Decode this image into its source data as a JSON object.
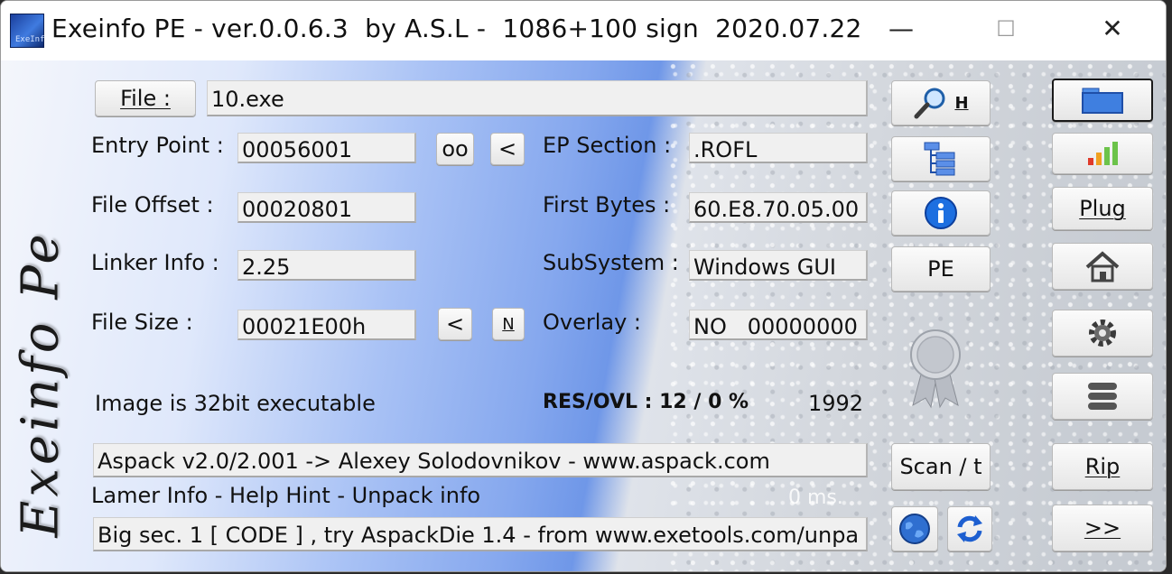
{
  "window": {
    "title": "Exeinfo PE - ver.0.0.6.3  by A.S.L -  1086+100 sign  2020.07.22",
    "icon_text": "ExeInf",
    "min_glyph": "—",
    "max_glyph": "☐",
    "close_glyph": "✕"
  },
  "logo_text": "Exeinfo Pe",
  "file": {
    "button_label": "File :",
    "value": "10.exe"
  },
  "fields": {
    "entry_point": {
      "label": "Entry Point :",
      "value": "00056001"
    },
    "file_offset": {
      "label": "File Offset :",
      "value": "00020801"
    },
    "linker_info": {
      "label": "Linker Info :",
      "value": "2.25"
    },
    "file_size": {
      "label": "File Size :",
      "value": "00021E00h"
    },
    "ep_section": {
      "label": "EP Section :",
      "value": ".ROFL"
    },
    "first_bytes": {
      "label": "First Bytes :",
      "value": "60.E8.70.05.00"
    },
    "subsystem": {
      "label": "SubSystem :",
      "value": "Windows GUI"
    },
    "overlay": {
      "label": "Overlay :",
      "value": "NO   00000000"
    }
  },
  "small_buttons": {
    "oo": "oo",
    "ep_prev": "<",
    "size_prev": "<",
    "n": "N"
  },
  "image_info": "Image is 32bit executable",
  "res_ovl": "RES/OVL : 12 / 0 %",
  "year": "1992",
  "detection": "Aspack v2.0/2.001  -> Alexey Solodovnikov - www.aspack.com",
  "lamer_info": "Lamer Info - Help Hint - Unpack info",
  "time_ms": "0 ms.",
  "hint": "Big sec. 1 [ CODE ] , try AspackDie 1.4 - from www.exetools.com/unpa",
  "mid_buttons": {
    "search_h": "H",
    "pe": "PE",
    "scan": "Scan / t"
  },
  "right_buttons": {
    "plug": "Plug",
    "rip": "Rip",
    "next": ">>"
  },
  "colors": {
    "info_blue": "#1d6fe0",
    "bar_red": "#e03a2a",
    "bar_orange": "#f0a020",
    "bar_green": "#6cc34a"
  }
}
